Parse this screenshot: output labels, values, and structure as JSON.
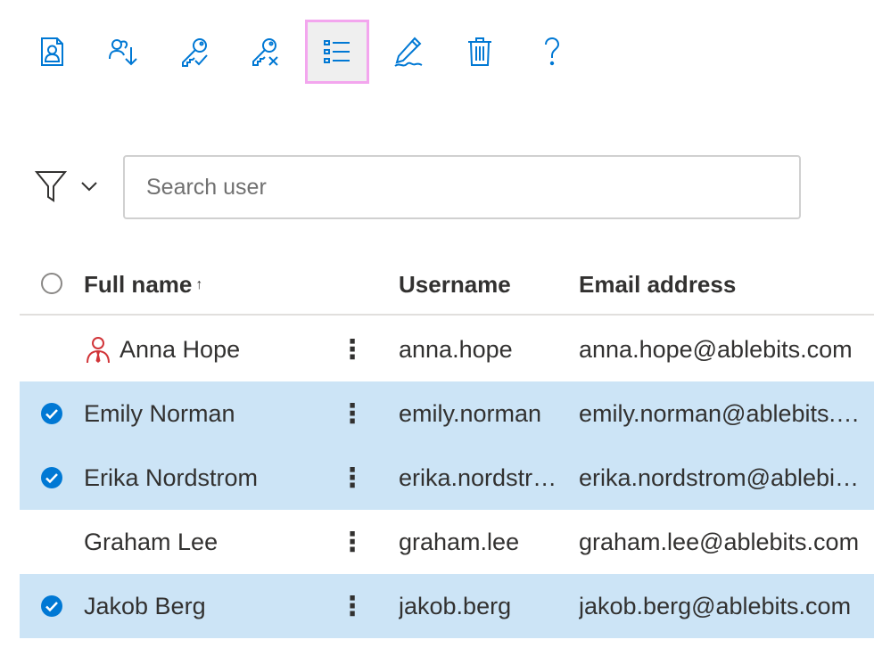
{
  "toolbar": {
    "buttons": [
      {
        "icon": "user-card-icon",
        "name": "user-details"
      },
      {
        "icon": "import-users-icon",
        "name": "import-users"
      },
      {
        "icon": "key-check-icon",
        "name": "grant-permission"
      },
      {
        "icon": "key-remove-icon",
        "name": "revoke-permission"
      },
      {
        "icon": "list-view-icon",
        "name": "list-view"
      },
      {
        "icon": "edit-pen-icon",
        "name": "edit-user"
      },
      {
        "icon": "trash-icon",
        "name": "delete-user"
      },
      {
        "icon": "help-icon",
        "name": "help"
      }
    ],
    "accent_color": "#0078d4"
  },
  "search": {
    "placeholder": "Search user"
  },
  "table": {
    "columns": {
      "full_name": "Full name",
      "sort_arrow": "↑",
      "username": "Username",
      "email": "Email address"
    },
    "rows": [
      {
        "full_name": "Anna Hope",
        "username": "anna.hope",
        "email": "anna.hope@ablebits.com",
        "selected": false,
        "admin": true
      },
      {
        "full_name": "Emily Norman",
        "username": "emily.norman",
        "email": "emily.norman@ablebits.com",
        "selected": true,
        "admin": false
      },
      {
        "full_name": "Erika Nordstrom",
        "username": "erika.nordstrom",
        "email": "erika.nordstrom@ablebits.com",
        "selected": true,
        "admin": false
      },
      {
        "full_name": "Graham Lee",
        "username": "graham.lee",
        "email": "graham.lee@ablebits.com",
        "selected": false,
        "admin": false
      },
      {
        "full_name": "Jakob Berg",
        "username": "jakob.berg",
        "email": "jakob.berg@ablebits.com",
        "selected": true,
        "admin": false
      }
    ],
    "more_glyph": "⋮",
    "selected_color": "#cce4f6",
    "admin_icon_color": "#d13438"
  }
}
